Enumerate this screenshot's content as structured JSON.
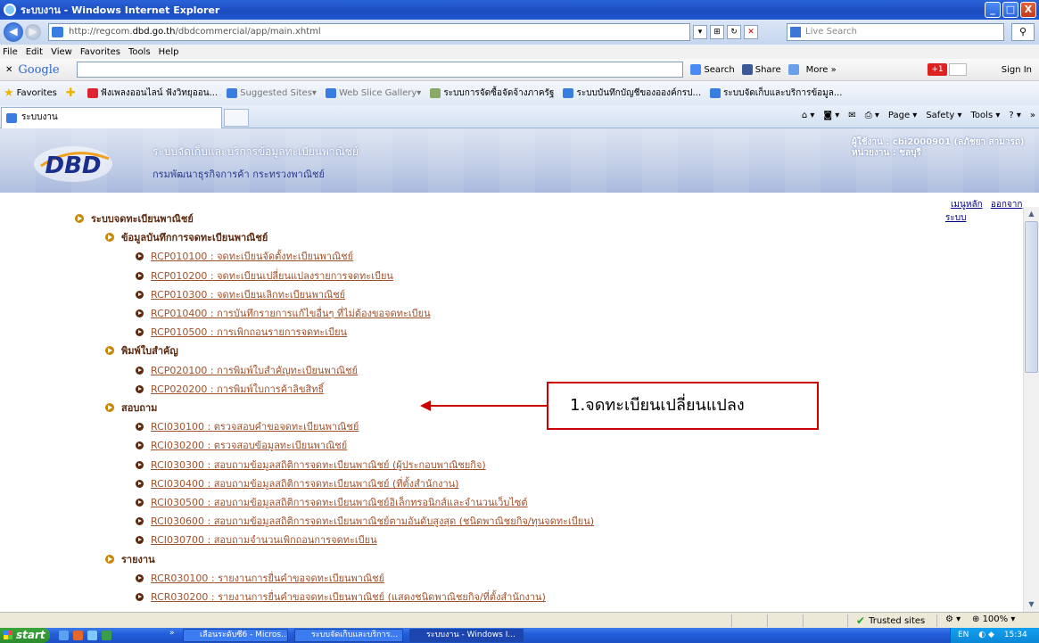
{
  "window": {
    "title": "ระบบงาน - Windows Internet Explorer",
    "buttons": [
      "_",
      "□",
      "X"
    ]
  },
  "address": {
    "prefix": "http://regcom.",
    "domain": "dbd.go.th",
    "path": "/dbdcommercial/app/main.xhtml",
    "live_search_placeholder": "Live Search"
  },
  "menu": [
    "File",
    "Edit",
    "View",
    "Favorites",
    "Tools",
    "Help"
  ],
  "google_bar": {
    "logo": "Google",
    "search": "Search",
    "share": "Share",
    "more": "More »",
    "sign_in": "Sign In",
    "plus": "+1"
  },
  "favorites_bar": {
    "favorites_label": "Favorites",
    "items": [
      "ฟังเพลงออนไลน์ ฟังวิทยุออน...",
      "Suggested Sites",
      "Web Slice Gallery",
      "ระบบการจัดซื้อจัดจ้างภาครัฐ",
      "ระบบบันทึกบัญชีของอองค์กรป...",
      "ระบบจัดเก็บและบริการข้อมูล..."
    ]
  },
  "tab": {
    "label": "ระบบงาน"
  },
  "commandbar": {
    "page": "Page",
    "safety": "Safety",
    "tools": "Tools"
  },
  "banner": {
    "logo_text": "DBD",
    "system_title": "ระบบจัดเก็บและบริการข้อมูลทะเบียนพาณิชย์",
    "org_title": "กรมพัฒนาธุรกิจการค้า กระทรวงพาณิชย์",
    "user_line": "ผู้ใช้งาน : cbi2000901 (ลภัชยา สามารถ)",
    "unit_line": "หน่วยงาน : ชลบุรี"
  },
  "top_links": {
    "main_menu": "เมนูหลัก",
    "logout": "ออกจากระบบ"
  },
  "tree": {
    "root": "ระบบจดทะเบียนพาณิชย์",
    "groups": [
      {
        "label": "ข้อมูลบันทึกการจดทะเบียนพาณิชย์",
        "items": [
          "RCP010100 : จดทะเบียนจัดตั้งทะเบียนพาณิชย์",
          "RCP010200 : จดทะเบียนเปลี่ยนแปลงรายการจดทะเบียน",
          "RCP010300 : จดทะเบียนเลิกทะเบียนพาณิชย์",
          "RCP010400 : การบันทึกรายการแก้ไขอื่นๆ ที่ไม่ต้องขอจดทะเบียน",
          "RCP010500 : การเพิกถอนรายการจดทะเบียน"
        ]
      },
      {
        "label": "พิมพ์ใบสำคัญ",
        "items": [
          "RCP020100 : การพิมพ์ใบสำคัญทะเบียนพาณิชย์",
          "RCP020200 : การพิมพ์ใบการค้าลิขสิทธิ์"
        ]
      },
      {
        "label": "สอบถาม",
        "items": [
          "RCI030100 : ตรวจสอบคำขอจดทะเบียนพาณิชย์",
          "RCI030200 : ตรวจสอบข้อมูลทะเบียนพาณิชย์",
          "RCI030300 : สอบถามข้อมูลสถิติการจดทะเบียนพาณิชย์ (ผู้ประกอบพาณิชยกิจ)",
          "RCI030400 : สอบถามข้อมูลสถิติการจดทะเบียนพาณิชย์ (ที่ตั้งสำนักงาน)",
          "RCI030500 : สอบถามข้อมูลสถิติการจดทะเบียนพาณิชย์อิเล็กทรอนิกส์และจำนวนเว็บไซต์",
          "RCI030600 : สอบถามข้อมูลสถิติการจดทะเบียนพาณิชย์ตามอันดับสูงสุด (ชนิดพาณิชยกิจ/ทุนจดทะเบียน)",
          "RCI030700 : สอบถามจำนวนเพิกถอนการจดทะเบียน"
        ]
      },
      {
        "label": "รายงาน",
        "items": [
          "RCR030100 : รายงานการยื่นคำขอจดทะเบียนพาณิชย์",
          "RCR030200 : รายงานการยื่นคำขอจดทะเบียนพาณิชย์ (แสดงชนิดพาณิชยกิจ/ที่ตั้งสำนักงาน)"
        ]
      }
    ]
  },
  "callout": {
    "text": "1.จดทะเบียนเปลี่ยนแปลง"
  },
  "status": {
    "zone": "Trusted sites",
    "zoom": "100%"
  },
  "taskbar": {
    "start": "start",
    "tasks": [
      "เลื่อนระดับซี6 - Micros...",
      "ระบบจัดเก็บและบริการ...",
      "ระบบงาน - Windows I..."
    ],
    "lang": "EN",
    "clock": "15:34"
  }
}
